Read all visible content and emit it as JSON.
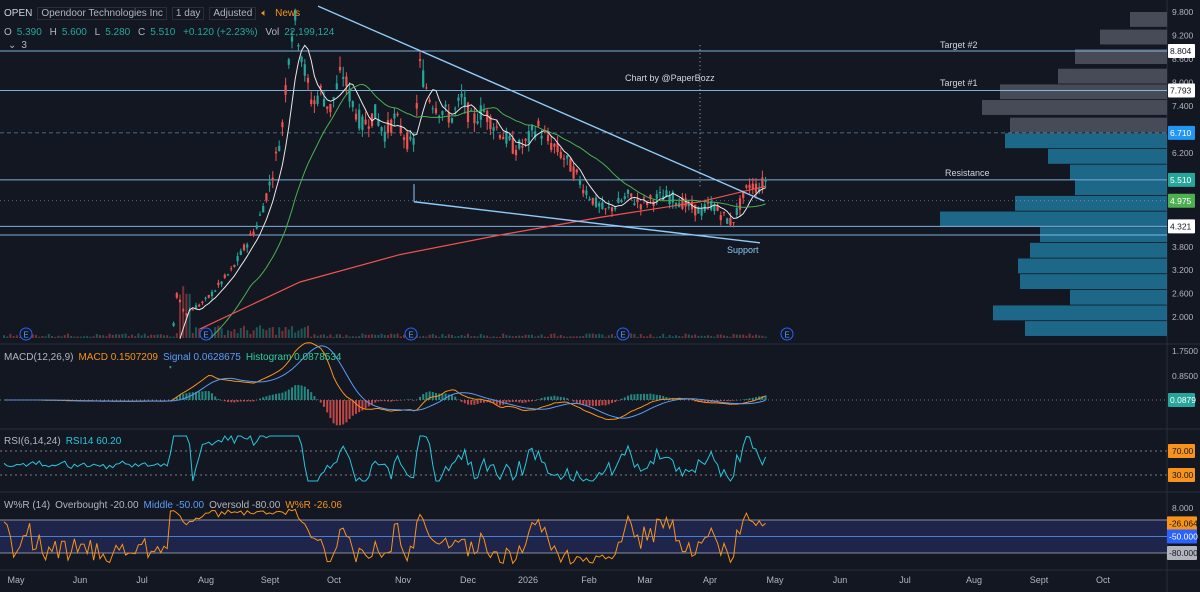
{
  "header": {
    "symbol": "OPEN",
    "name": "Opendoor Technologies Inc",
    "interval": "1 day",
    "adjust": "Adjusted",
    "news": "News",
    "ohlc": {
      "o_label": "O",
      "o": "5.390",
      "h_label": "H",
      "h": "5.600",
      "l_label": "L",
      "l": "5.280",
      "c_label": "C",
      "c": "5.510",
      "change": "+0.120 (+2.23%)",
      "vol_label": "Vol",
      "vol": "22,199,124"
    },
    "collapse": "3"
  },
  "annotations": {
    "credit": "Chart by @PaperBozz",
    "target2": "Target #2",
    "target1": "Target #1",
    "resistance": "Resistance",
    "support": "Support",
    "earnings_marker": "E"
  },
  "price_axis": {
    "ticks": [
      "9.800",
      "9.200",
      "8.600",
      "8.000",
      "7.400",
      "6.800",
      "6.200",
      "5.600",
      "5.000",
      "4.400",
      "3.800",
      "3.200",
      "2.600",
      "2.000"
    ],
    "badges": [
      {
        "text": "8.804",
        "value": 8.804,
        "bg": "#ffffff",
        "fg": "#131722"
      },
      {
        "text": "7.793",
        "value": 7.793,
        "bg": "#ffffff",
        "fg": "#131722"
      },
      {
        "text": "6.710",
        "value": 6.71,
        "bg": "#2196f3",
        "fg": "#ffffff"
      },
      {
        "text": "5.510",
        "value": 5.51,
        "bg": "#26a69a",
        "fg": "#ffffff"
      },
      {
        "text": "4.975",
        "value": 4.975,
        "bg": "#4caf50",
        "fg": "#ffffff"
      },
      {
        "text": "4.321",
        "value": 4.321,
        "bg": "#ffffff",
        "fg": "#131722"
      }
    ]
  },
  "macd": {
    "title": "MACD(12,26,9)",
    "macd_label": "MACD 0.1507209",
    "signal_label": "Signal 0.0628675",
    "hist_label": "Histogram 0.0878534",
    "ticks": [
      "1.7500",
      "0.8500"
    ],
    "badge": "0.0879"
  },
  "rsi": {
    "title": "RSI(6,14,24)",
    "label": "RSI14 60.20",
    "ticks": [
      "95.00"
    ],
    "badges": [
      "70.00",
      "30.00"
    ]
  },
  "wr": {
    "title": "W%R (14)",
    "overbought": "Overbought -20.00",
    "middle": "Middle -50.00",
    "oversold": "Oversold -80.00",
    "value_label": "W%R -26.06",
    "ticks": [
      "8.000"
    ],
    "badges": [
      "-26.064",
      "-50.000",
      "-80.000"
    ]
  },
  "time_axis": [
    "May",
    "Jun",
    "Jul",
    "Aug",
    "Sept",
    "Oct",
    "Nov",
    "Dec",
    "2026",
    "Feb",
    "Mar",
    "Apr",
    "May",
    "Jun",
    "Jul",
    "Aug",
    "Sept",
    "Oct"
  ],
  "chart_data": {
    "type": "line",
    "title": "OPEN · Opendoor Technologies Inc · 1 day",
    "x_range": [
      "May",
      "Oct"
    ],
    "price_ylim": [
      1.6,
      10.0
    ],
    "grid": false,
    "close_path": [
      {
        "x": "2025-05-01",
        "y": 0.9
      },
      {
        "x": "2025-06-01",
        "y": 0.6
      },
      {
        "x": "2025-07-01",
        "y": 0.7
      },
      {
        "x": "2025-07-15",
        "y": 2.6
      },
      {
        "x": "2025-08-01",
        "y": 2.4
      },
      {
        "x": "2025-08-20",
        "y": 3.5
      },
      {
        "x": "2025-09-01",
        "y": 6.8
      },
      {
        "x": "2025-09-10",
        "y": 9.5
      },
      {
        "x": "2025-09-25",
        "y": 7.6
      },
      {
        "x": "2025-10-15",
        "y": 7.0
      },
      {
        "x": "2025-11-05",
        "y": 8.5
      },
      {
        "x": "2025-11-25",
        "y": 7.2
      },
      {
        "x": "2025-12-15",
        "y": 7.0
      },
      {
        "x": "2026-01-10",
        "y": 6.3
      },
      {
        "x": "2026-02-01",
        "y": 5.2
      },
      {
        "x": "2026-02-20",
        "y": 4.6
      },
      {
        "x": "2026-03-10",
        "y": 5.1
      },
      {
        "x": "2026-04-01",
        "y": 4.6
      },
      {
        "x": "2026-04-10",
        "y": 4.3
      },
      {
        "x": "2026-04-25",
        "y": 5.51
      }
    ],
    "levels": [
      {
        "name": "Target #2",
        "value": 8.804
      },
      {
        "name": "Target #1",
        "value": 7.793
      },
      {
        "name": "Resistance",
        "value": 5.51
      },
      {
        "name": "Support",
        "value": 4.321
      }
    ],
    "indicators": {
      "macd": 0.1507209,
      "signal": 0.0628675,
      "histogram": 0.0878534,
      "rsi14": 60.2,
      "rsi_bands": [
        70,
        30
      ],
      "williams_r": -26.06,
      "wr_levels": {
        "overbought": -20,
        "middle": -50,
        "oversold": -80
      }
    }
  },
  "colors": {
    "background": "#131722",
    "up": "#26a69a",
    "down": "#ef5350",
    "trendline": "#90caf9",
    "level_line": "#90caf9",
    "sma_fast": "#e8e8e8",
    "sma_mid": "#4caf50",
    "sma_slow": "#ef5350",
    "volume_profile": "#1e6b8f",
    "volume_profile_upper": "#4a4e5c",
    "macd_line": "#f7931a",
    "signal_line": "#5b9cf6",
    "rsi_line": "#26c6da",
    "wr_line": "#f7931a",
    "wr_band": "#2a2f6e"
  }
}
